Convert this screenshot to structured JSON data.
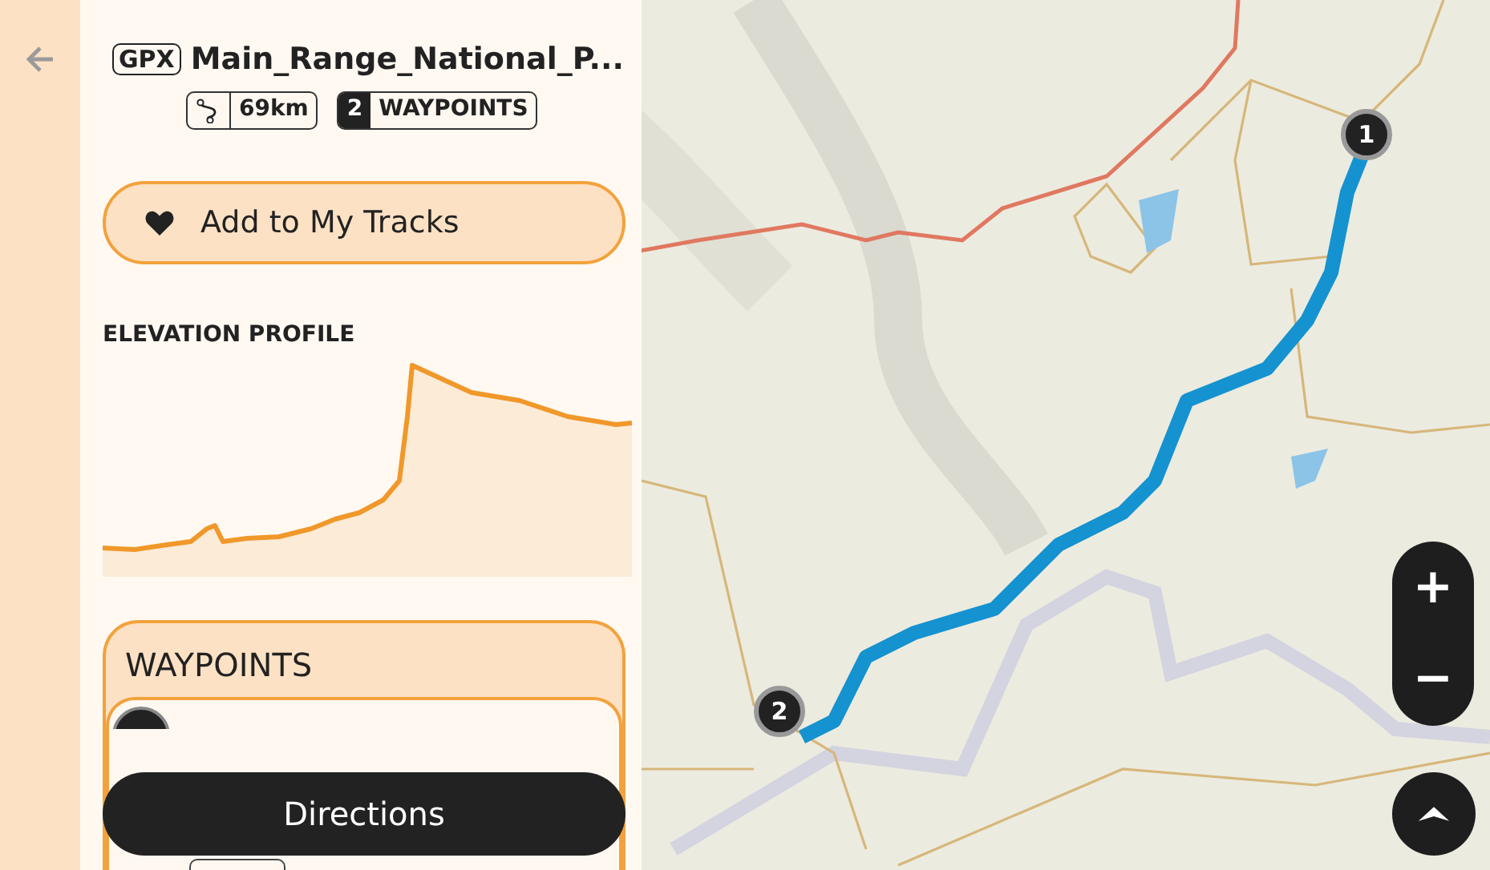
{
  "track": {
    "format_badge": "GPX",
    "title": "Main_Range_National_P...",
    "distance": "69km",
    "waypoint_count": "2",
    "waypoint_label": "WAYPOINTS"
  },
  "add_button": {
    "label": "Add to My Tracks"
  },
  "elevation": {
    "title": "ELEVATION PROFILE"
  },
  "waypoints": {
    "title": "WAYPOINTS"
  },
  "directions_button": {
    "label": "Directions"
  },
  "map": {
    "markers": [
      {
        "label": "1"
      },
      {
        "label": "2"
      }
    ],
    "zoom": [
      {
        "label": "+"
      },
      {
        "label": "−"
      }
    ]
  }
}
